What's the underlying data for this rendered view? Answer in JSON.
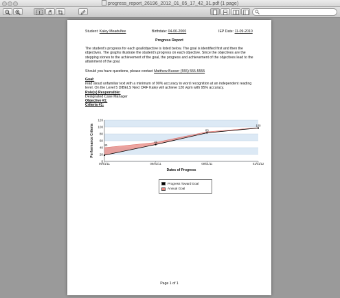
{
  "window": {
    "title": "progress_report_26196_2012_01_05_17_42_31.pdf (1 page)"
  },
  "toolbar": {
    "search_placeholder": ""
  },
  "report": {
    "student_label": "Student:",
    "student_name": "Kaley Meadulfee",
    "birthdate_label": "Birthdate:",
    "birthdate": "04-06-2000",
    "iep_label": "IEP Date:",
    "iep_date": "11-09-2010",
    "heading": "Progress Report",
    "intro": "The student's progress for each goal/objective is listed below. The goal is identified first and then the objectives. The graphs illustrate the student's progress on each objective. Since the objectives are the stepping stones to the achievement of the goal, the progress and achievement of the objectives lead to the attainment of the goal.",
    "contact_prefix": "Should you have questions, please contact",
    "contact_name": "Matthew Busser (555) 555-5555",
    "goal_label": "Goal:",
    "goal_text": "read aloud unfamiliar text with a minimum of 90% accuracy in word recognition at an independent reading level. On the Level 5 DIBELS Next ORF Kaley will achieve 120 wpm with 95% accuracy.",
    "role_label": "Role(s) Responsible:",
    "role_text": "Designated Case Manager",
    "objective_label": "Objective #1:",
    "criteria_label": "Criteria #1:",
    "footer": "Page 1 of 1"
  },
  "chart_data": {
    "type": "line",
    "ylabel": "Performance Criteria",
    "xlabel": "Dates of Progress",
    "ylim": [
      0,
      120
    ],
    "yticks": [
      0,
      20,
      40,
      60,
      80,
      100,
      120
    ],
    "categories": [
      "09/01/11",
      "09/01/11",
      "09/01/11",
      "01/01/12"
    ],
    "series": [
      {
        "name": "Progress Toward Goal",
        "color": "#000000",
        "values": [
          18,
          49,
          83,
          97
        ]
      },
      {
        "name": "Annual Goal",
        "color": "#e8857f",
        "values": [
          40,
          55,
          86,
          98
        ]
      }
    ],
    "data_labels": [
      "40",
      "49",
      "83",
      "100"
    ],
    "legend": "bottom-center",
    "grid": "horizontal-bands"
  }
}
